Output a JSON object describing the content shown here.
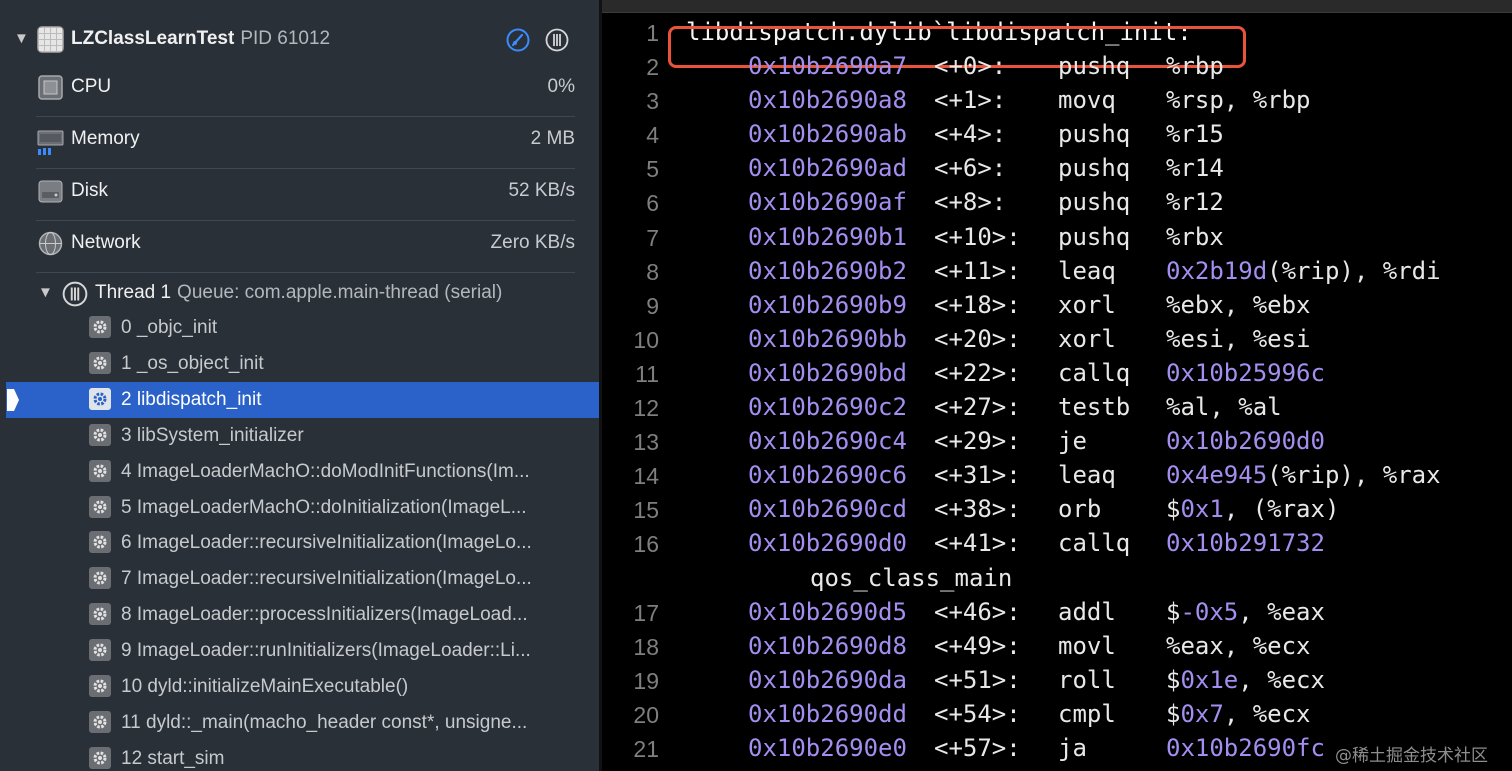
{
  "process": {
    "name": "LZClassLearnTest",
    "pid": "PID 61012"
  },
  "gauges": [
    {
      "label": "CPU",
      "value": "0%",
      "icon": "cpu-icon"
    },
    {
      "label": "Memory",
      "value": "2 MB",
      "icon": "memory-icon"
    },
    {
      "label": "Disk",
      "value": "52 KB/s",
      "icon": "disk-icon"
    },
    {
      "label": "Network",
      "value": "Zero KB/s",
      "icon": "network-icon"
    }
  ],
  "thread": {
    "name": "Thread 1",
    "queue": "Queue: com.apple.main-thread (serial)"
  },
  "frames": [
    "0 _objc_init",
    "1 _os_object_init",
    "2 libdispatch_init",
    "3 libSystem_initializer",
    "4 ImageLoaderMachO::doModInitFunctions(Im...",
    "5 ImageLoaderMachO::doInitialization(ImageL...",
    "6 ImageLoader::recursiveInitialization(ImageLo...",
    "7 ImageLoader::recursiveInitialization(ImageLo...",
    "8 ImageLoader::processInitializers(ImageLoad...",
    "9 ImageLoader::runInitializers(ImageLoader::Li...",
    "10 dyld::initializeMainExecutable()",
    "11 dyld::_main(macho_header const*, unsigne...",
    "12 start_sim"
  ],
  "selected_frame_index": 2,
  "code": {
    "symbol_line": {
      "line": "1",
      "text": "libdispatch.dylib`libdispatch_init:"
    },
    "lines": [
      {
        "line": "2",
        "addr": "0x10b2690a7",
        "off": "<+0>:",
        "mn": "pushq",
        "ops": [
          {
            "t": "%rbp"
          }
        ]
      },
      {
        "line": "3",
        "addr": "0x10b2690a8",
        "off": "<+1>:",
        "mn": "movq",
        "ops": [
          {
            "t": "%rsp, %rbp"
          }
        ]
      },
      {
        "line": "4",
        "addr": "0x10b2690ab",
        "off": "<+4>:",
        "mn": "pushq",
        "ops": [
          {
            "t": "%r15"
          }
        ]
      },
      {
        "line": "5",
        "addr": "0x10b2690ad",
        "off": "<+6>:",
        "mn": "pushq",
        "ops": [
          {
            "t": "%r14"
          }
        ]
      },
      {
        "line": "6",
        "addr": "0x10b2690af",
        "off": "<+8>:",
        "mn": "pushq",
        "ops": [
          {
            "t": "%r12"
          }
        ]
      },
      {
        "line": "7",
        "addr": "0x10b2690b1",
        "off": "<+10>:",
        "mn": "pushq",
        "ops": [
          {
            "t": "%rbx"
          }
        ]
      },
      {
        "line": "8",
        "addr": "0x10b2690b2",
        "off": "<+11>:",
        "mn": "leaq",
        "ops": [
          {
            "t": "0x2b19d",
            "n": true
          },
          {
            "t": "(%rip), %rdi"
          }
        ]
      },
      {
        "line": "9",
        "addr": "0x10b2690b9",
        "off": "<+18>:",
        "mn": "xorl",
        "ops": [
          {
            "t": "%ebx, %ebx"
          }
        ]
      },
      {
        "line": "10",
        "addr": "0x10b2690bb",
        "off": "<+20>:",
        "mn": "xorl",
        "ops": [
          {
            "t": "%esi, %esi"
          }
        ]
      },
      {
        "line": "11",
        "addr": "0x10b2690bd",
        "off": "<+22>:",
        "mn": "callq",
        "ops": [
          {
            "t": "0x10b25996c",
            "n": true
          }
        ]
      },
      {
        "line": "12",
        "addr": "0x10b2690c2",
        "off": "<+27>:",
        "mn": "testb",
        "ops": [
          {
            "t": "%al, %al"
          }
        ]
      },
      {
        "line": "13",
        "addr": "0x10b2690c4",
        "off": "<+29>:",
        "mn": "je",
        "ops": [
          {
            "t": "0x10b2690d0",
            "n": true
          }
        ]
      },
      {
        "line": "14",
        "addr": "0x10b2690c6",
        "off": "<+31>:",
        "mn": "leaq",
        "ops": [
          {
            "t": "0x4e945",
            "n": true
          },
          {
            "t": "(%rip), %rax"
          }
        ]
      },
      {
        "line": "15",
        "addr": "0x10b2690cd",
        "off": "<+38>:",
        "mn": "orb",
        "ops": [
          {
            "t": "$"
          },
          {
            "t": "0x1",
            "n": true
          },
          {
            "t": ", (%rax)"
          }
        ]
      },
      {
        "line": "16",
        "addr": "0x10b2690d0",
        "off": "<+41>:",
        "mn": "callq",
        "ops": [
          {
            "t": "0x10b291732",
            "n": true
          }
        ],
        "cont": "qos_class_main"
      },
      {
        "line": "17",
        "addr": "0x10b2690d5",
        "off": "<+46>:",
        "mn": "addl",
        "ops": [
          {
            "t": "$"
          },
          {
            "t": "-0x5",
            "n": true
          },
          {
            "t": ", %eax"
          }
        ]
      },
      {
        "line": "18",
        "addr": "0x10b2690d8",
        "off": "<+49>:",
        "mn": "movl",
        "ops": [
          {
            "t": "%eax, %ecx"
          }
        ]
      },
      {
        "line": "19",
        "addr": "0x10b2690da",
        "off": "<+51>:",
        "mn": "roll",
        "ops": [
          {
            "t": "$"
          },
          {
            "t": "0x1e",
            "n": true
          },
          {
            "t": ", %ecx"
          }
        ]
      },
      {
        "line": "20",
        "addr": "0x10b2690dd",
        "off": "<+54>:",
        "mn": "cmpl",
        "ops": [
          {
            "t": "$"
          },
          {
            "t": "0x7",
            "n": true
          },
          {
            "t": ", %ecx"
          }
        ]
      },
      {
        "line": "21",
        "addr": "0x10b2690e0",
        "off": "<+57>:",
        "mn": "ja",
        "ops": [
          {
            "t": "0x10b2690fc",
            "n": true
          }
        ]
      }
    ]
  },
  "watermark": "@稀土掘金技术社区",
  "colors": {
    "selection": "#2a62c9",
    "highlight_box": "#e8533a",
    "number": "#a48ef0"
  }
}
